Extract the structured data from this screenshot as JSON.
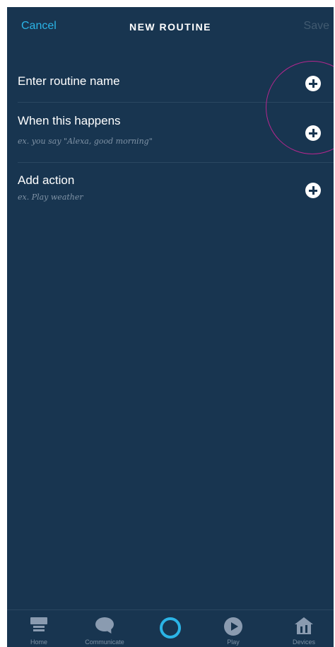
{
  "header": {
    "cancel_label": "Cancel",
    "title": "NEW ROUTINE",
    "save_label": "Save"
  },
  "rows": [
    {
      "label": "Enter routine name",
      "hint": "",
      "icon": "plus-icon"
    },
    {
      "label": "When this happens",
      "hint": "ex. you say \"Alexa, good morning\"",
      "icon": "plus-icon"
    },
    {
      "label": "Add action",
      "hint": "ex. Play weather",
      "icon": "plus-icon"
    }
  ],
  "tabs": [
    {
      "label": "Home",
      "icon": "home-icon"
    },
    {
      "label": "Communicate",
      "icon": "chat-bubble-icon"
    },
    {
      "label": "",
      "icon": "alexa-icon"
    },
    {
      "label": "Play",
      "icon": "play-icon"
    },
    {
      "label": "Devices",
      "icon": "devices-icon"
    }
  ],
  "colors": {
    "background": "#183550",
    "accent": "#2bb4e6",
    "highlight_circle": "#b4278e",
    "disabled_text": "#415a70"
  }
}
